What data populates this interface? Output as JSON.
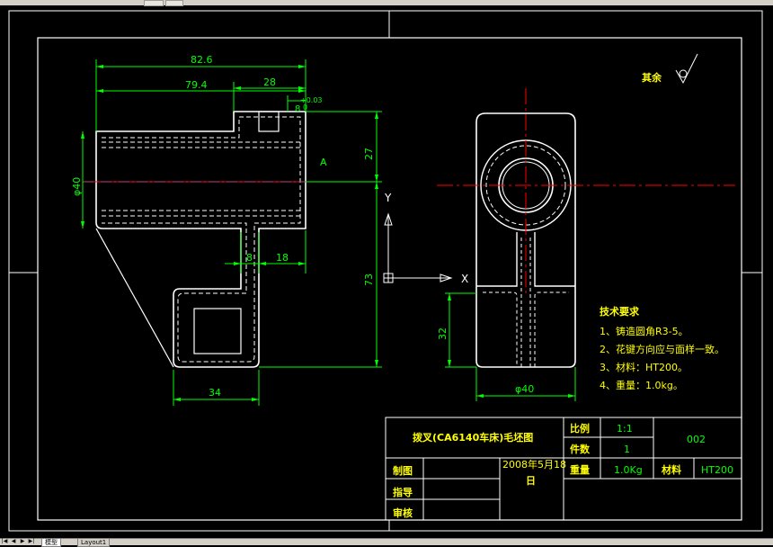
{
  "dimensions": {
    "d82_6": "82.6",
    "d79_4": "79.4",
    "d28": "28",
    "d8_top": "8",
    "tol": "+0.03",
    "tol0": "0",
    "d27": "27",
    "d73": "73",
    "d8": "8",
    "d18": "18",
    "d34": "34",
    "phi40_left": "φ40",
    "phi40_bottom": "φ40",
    "d32": "32",
    "label_A": "A"
  },
  "ucs": {
    "y_axis": "Y",
    "x_axis": "X"
  },
  "surface_note": {
    "label": "其余"
  },
  "tech_requirements": {
    "title": "技术要求",
    "items": [
      "1、铸造圆角R3-5。",
      "2、花键方向应与面样一致。",
      "3、材料：HT200。",
      "4、重量：1.0kg。"
    ]
  },
  "title_block": {
    "name": "拨叉(CA6140车床)毛坯图",
    "scale_label": "比例",
    "scale_value": "1:1",
    "qty_label": "件数",
    "qty_value": "1",
    "drawing_no": "002",
    "weight_label": "重量",
    "weight_value": "1.0Kg",
    "material_label": "材料",
    "material_value": "HT200",
    "drawn_label": "制图",
    "guide_label": "指导",
    "review_label": "审核",
    "date_line1": "2008年5月18",
    "date_line2": "日"
  },
  "tabs": {
    "model": "模型",
    "layout": "Layout1"
  },
  "colors": {
    "background": "#000000",
    "outline": "#ffffff",
    "dimension": "#00ff00",
    "centerline": "#ff0000",
    "text_yellow": "#ffff00"
  }
}
